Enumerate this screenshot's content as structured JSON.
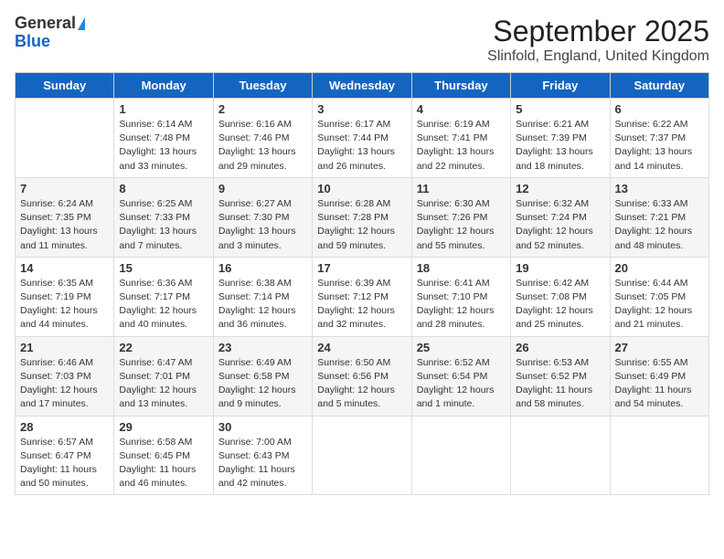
{
  "header": {
    "logo_general": "General",
    "logo_blue": "Blue",
    "title": "September 2025",
    "subtitle": "Slinfold, England, United Kingdom"
  },
  "days_of_week": [
    "Sunday",
    "Monday",
    "Tuesday",
    "Wednesday",
    "Thursday",
    "Friday",
    "Saturday"
  ],
  "weeks": [
    [
      {
        "day": "",
        "content": ""
      },
      {
        "day": "1",
        "content": "Sunrise: 6:14 AM\nSunset: 7:48 PM\nDaylight: 13 hours\nand 33 minutes."
      },
      {
        "day": "2",
        "content": "Sunrise: 6:16 AM\nSunset: 7:46 PM\nDaylight: 13 hours\nand 29 minutes."
      },
      {
        "day": "3",
        "content": "Sunrise: 6:17 AM\nSunset: 7:44 PM\nDaylight: 13 hours\nand 26 minutes."
      },
      {
        "day": "4",
        "content": "Sunrise: 6:19 AM\nSunset: 7:41 PM\nDaylight: 13 hours\nand 22 minutes."
      },
      {
        "day": "5",
        "content": "Sunrise: 6:21 AM\nSunset: 7:39 PM\nDaylight: 13 hours\nand 18 minutes."
      },
      {
        "day": "6",
        "content": "Sunrise: 6:22 AM\nSunset: 7:37 PM\nDaylight: 13 hours\nand 14 minutes."
      }
    ],
    [
      {
        "day": "7",
        "content": "Sunrise: 6:24 AM\nSunset: 7:35 PM\nDaylight: 13 hours\nand 11 minutes."
      },
      {
        "day": "8",
        "content": "Sunrise: 6:25 AM\nSunset: 7:33 PM\nDaylight: 13 hours\nand 7 minutes."
      },
      {
        "day": "9",
        "content": "Sunrise: 6:27 AM\nSunset: 7:30 PM\nDaylight: 13 hours\nand 3 minutes."
      },
      {
        "day": "10",
        "content": "Sunrise: 6:28 AM\nSunset: 7:28 PM\nDaylight: 12 hours\nand 59 minutes."
      },
      {
        "day": "11",
        "content": "Sunrise: 6:30 AM\nSunset: 7:26 PM\nDaylight: 12 hours\nand 55 minutes."
      },
      {
        "day": "12",
        "content": "Sunrise: 6:32 AM\nSunset: 7:24 PM\nDaylight: 12 hours\nand 52 minutes."
      },
      {
        "day": "13",
        "content": "Sunrise: 6:33 AM\nSunset: 7:21 PM\nDaylight: 12 hours\nand 48 minutes."
      }
    ],
    [
      {
        "day": "14",
        "content": "Sunrise: 6:35 AM\nSunset: 7:19 PM\nDaylight: 12 hours\nand 44 minutes."
      },
      {
        "day": "15",
        "content": "Sunrise: 6:36 AM\nSunset: 7:17 PM\nDaylight: 12 hours\nand 40 minutes."
      },
      {
        "day": "16",
        "content": "Sunrise: 6:38 AM\nSunset: 7:14 PM\nDaylight: 12 hours\nand 36 minutes."
      },
      {
        "day": "17",
        "content": "Sunrise: 6:39 AM\nSunset: 7:12 PM\nDaylight: 12 hours\nand 32 minutes."
      },
      {
        "day": "18",
        "content": "Sunrise: 6:41 AM\nSunset: 7:10 PM\nDaylight: 12 hours\nand 28 minutes."
      },
      {
        "day": "19",
        "content": "Sunrise: 6:42 AM\nSunset: 7:08 PM\nDaylight: 12 hours\nand 25 minutes."
      },
      {
        "day": "20",
        "content": "Sunrise: 6:44 AM\nSunset: 7:05 PM\nDaylight: 12 hours\nand 21 minutes."
      }
    ],
    [
      {
        "day": "21",
        "content": "Sunrise: 6:46 AM\nSunset: 7:03 PM\nDaylight: 12 hours\nand 17 minutes."
      },
      {
        "day": "22",
        "content": "Sunrise: 6:47 AM\nSunset: 7:01 PM\nDaylight: 12 hours\nand 13 minutes."
      },
      {
        "day": "23",
        "content": "Sunrise: 6:49 AM\nSunset: 6:58 PM\nDaylight: 12 hours\nand 9 minutes."
      },
      {
        "day": "24",
        "content": "Sunrise: 6:50 AM\nSunset: 6:56 PM\nDaylight: 12 hours\nand 5 minutes."
      },
      {
        "day": "25",
        "content": "Sunrise: 6:52 AM\nSunset: 6:54 PM\nDaylight: 12 hours\nand 1 minute."
      },
      {
        "day": "26",
        "content": "Sunrise: 6:53 AM\nSunset: 6:52 PM\nDaylight: 11 hours\nand 58 minutes."
      },
      {
        "day": "27",
        "content": "Sunrise: 6:55 AM\nSunset: 6:49 PM\nDaylight: 11 hours\nand 54 minutes."
      }
    ],
    [
      {
        "day": "28",
        "content": "Sunrise: 6:57 AM\nSunset: 6:47 PM\nDaylight: 11 hours\nand 50 minutes."
      },
      {
        "day": "29",
        "content": "Sunrise: 6:58 AM\nSunset: 6:45 PM\nDaylight: 11 hours\nand 46 minutes."
      },
      {
        "day": "30",
        "content": "Sunrise: 7:00 AM\nSunset: 6:43 PM\nDaylight: 11 hours\nand 42 minutes."
      },
      {
        "day": "",
        "content": ""
      },
      {
        "day": "",
        "content": ""
      },
      {
        "day": "",
        "content": ""
      },
      {
        "day": "",
        "content": ""
      }
    ]
  ]
}
